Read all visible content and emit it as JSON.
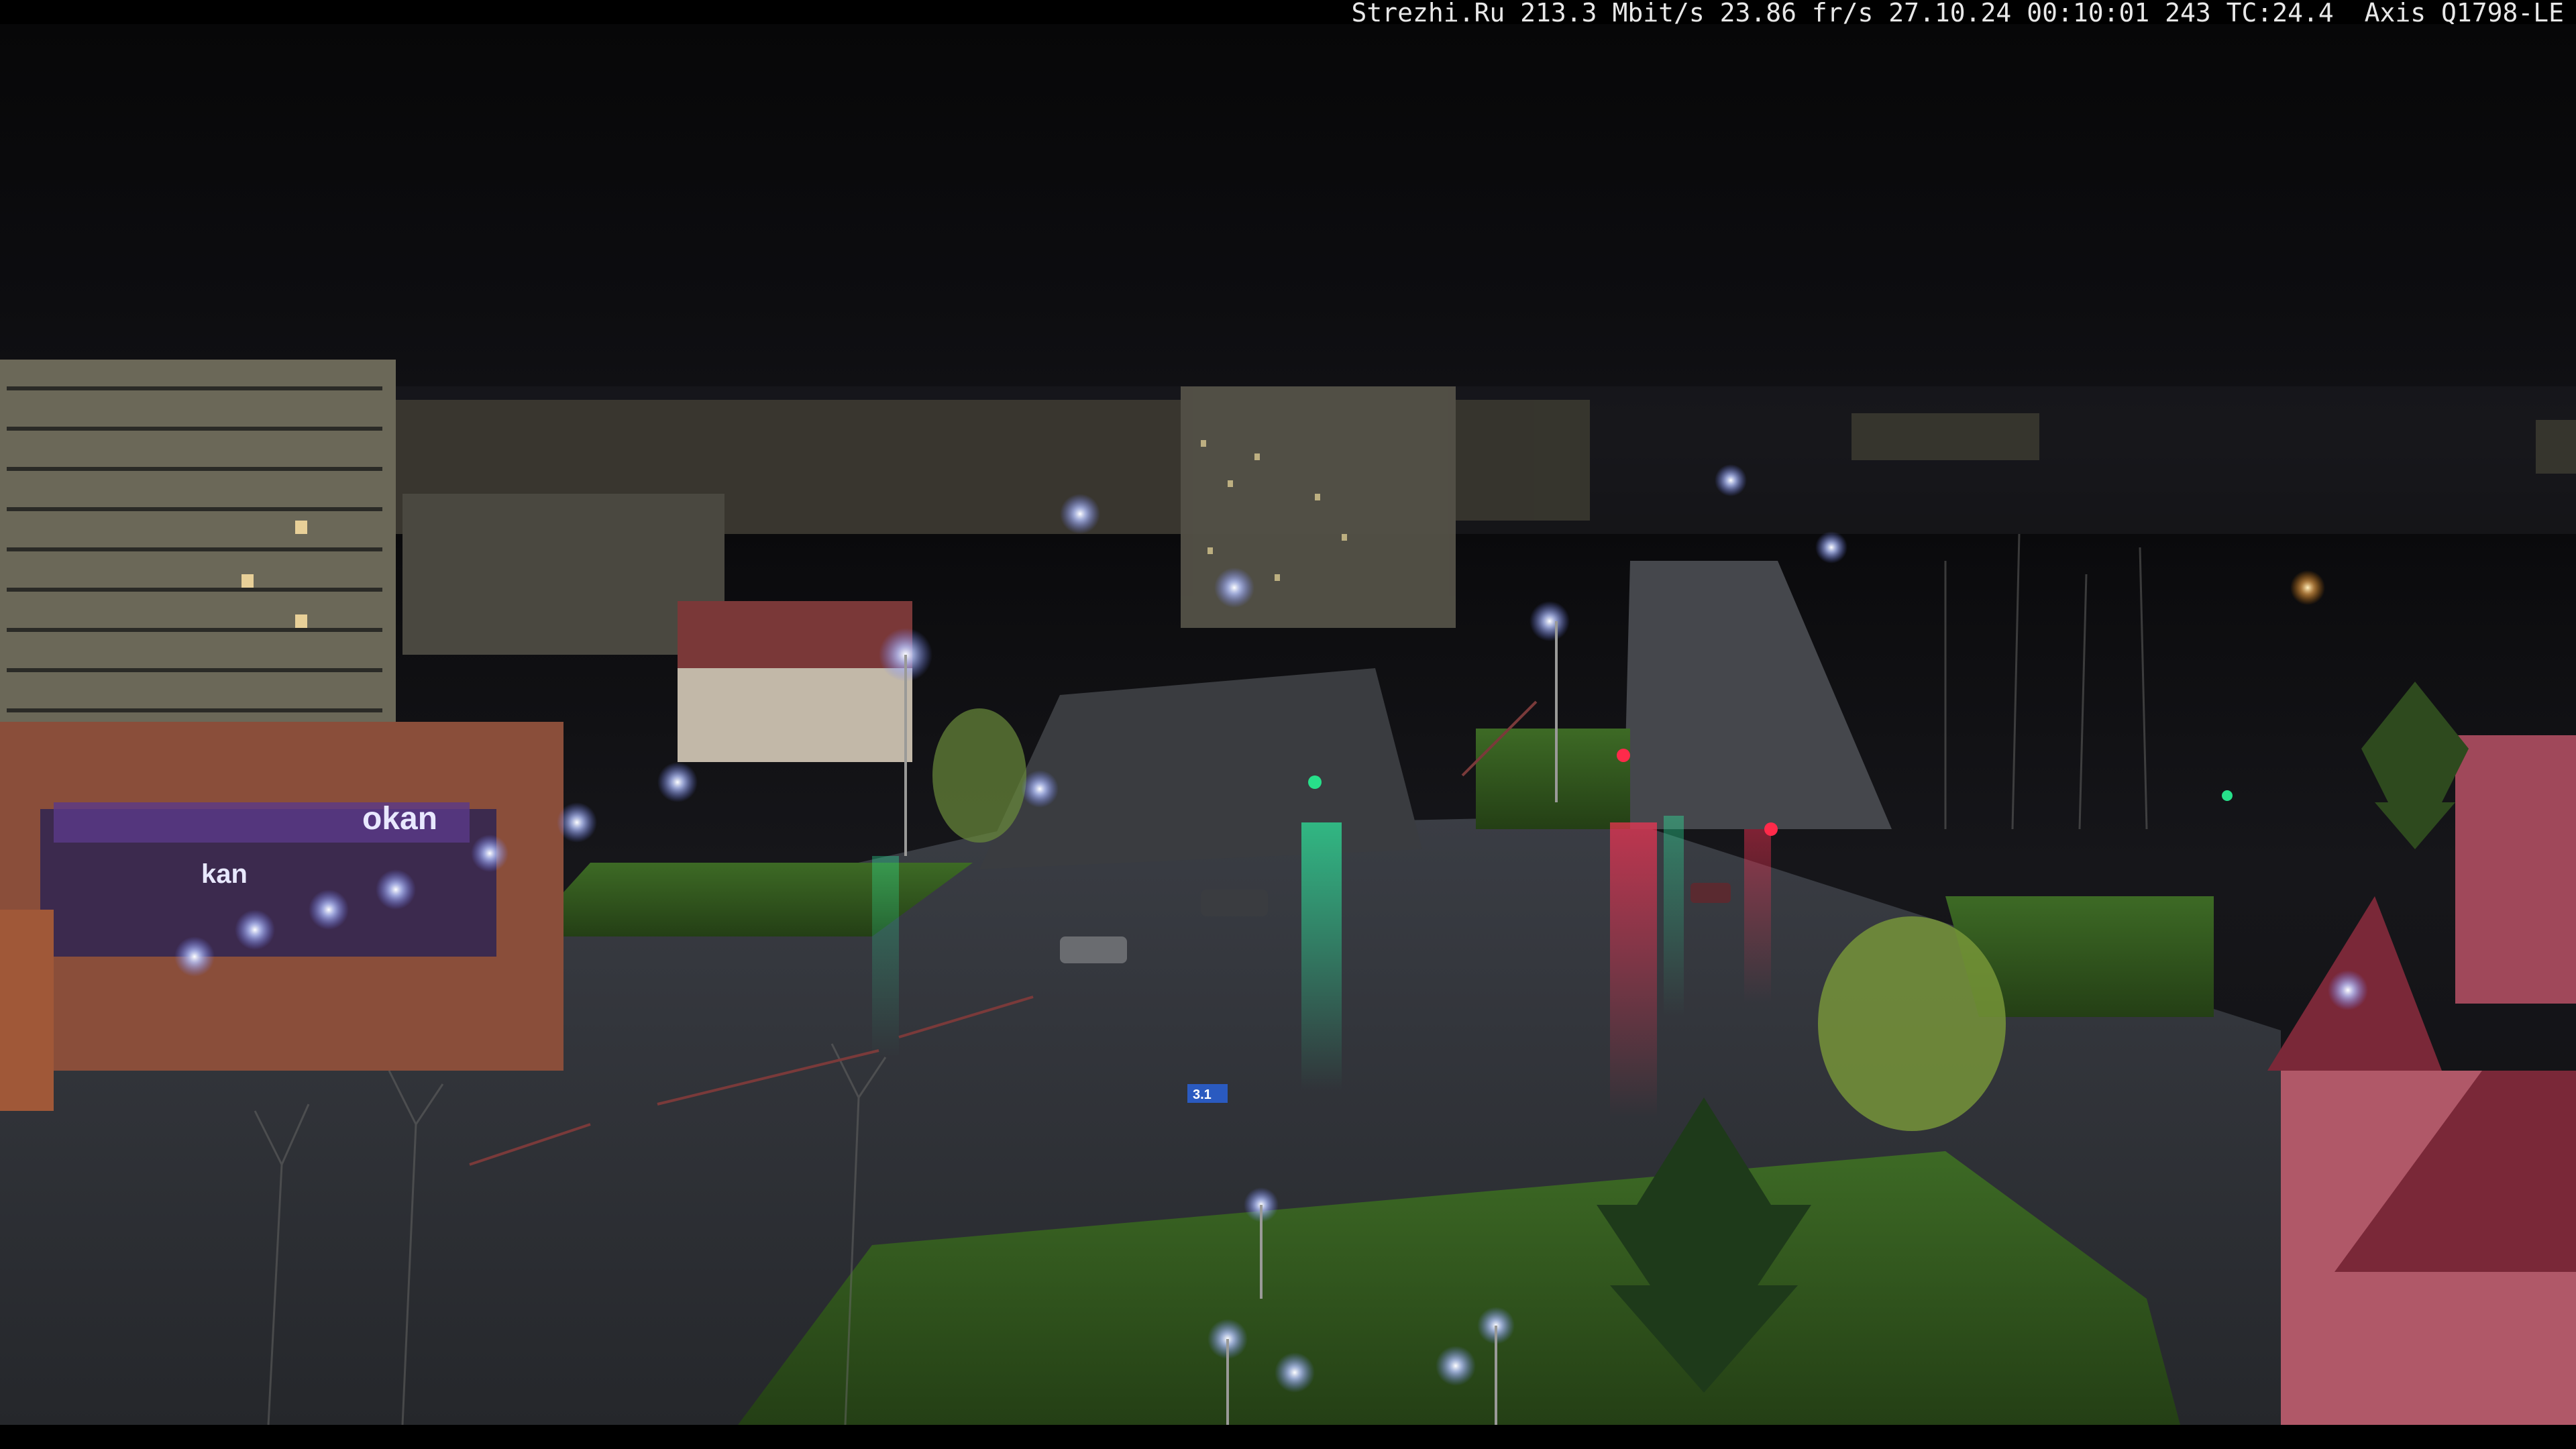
{
  "overlay": {
    "site": "Strezhi.Ru",
    "bitrate": "213.3 Mbit/s",
    "framerate": "23.86 fr/s",
    "date": "27.10.24",
    "time": "00:10:01",
    "frame_counter": "243",
    "temperature": "TC:24.4",
    "camera_model": "Axis Q1798-LE"
  },
  "scene": {
    "signs": {
      "store_main": "okan",
      "store_secondary": "kan",
      "road_sign": "3.1"
    },
    "colors": {
      "sky": "#0d0d10",
      "wet_asphalt": "#2a2c30",
      "grass": "#2f5a1e",
      "streetlight": "#bcc8ff",
      "traffic_green": "#27e08a",
      "traffic_red": "#ff2a4a",
      "building_panel": "#6b6858",
      "store_neon": "#7b4cff"
    }
  }
}
